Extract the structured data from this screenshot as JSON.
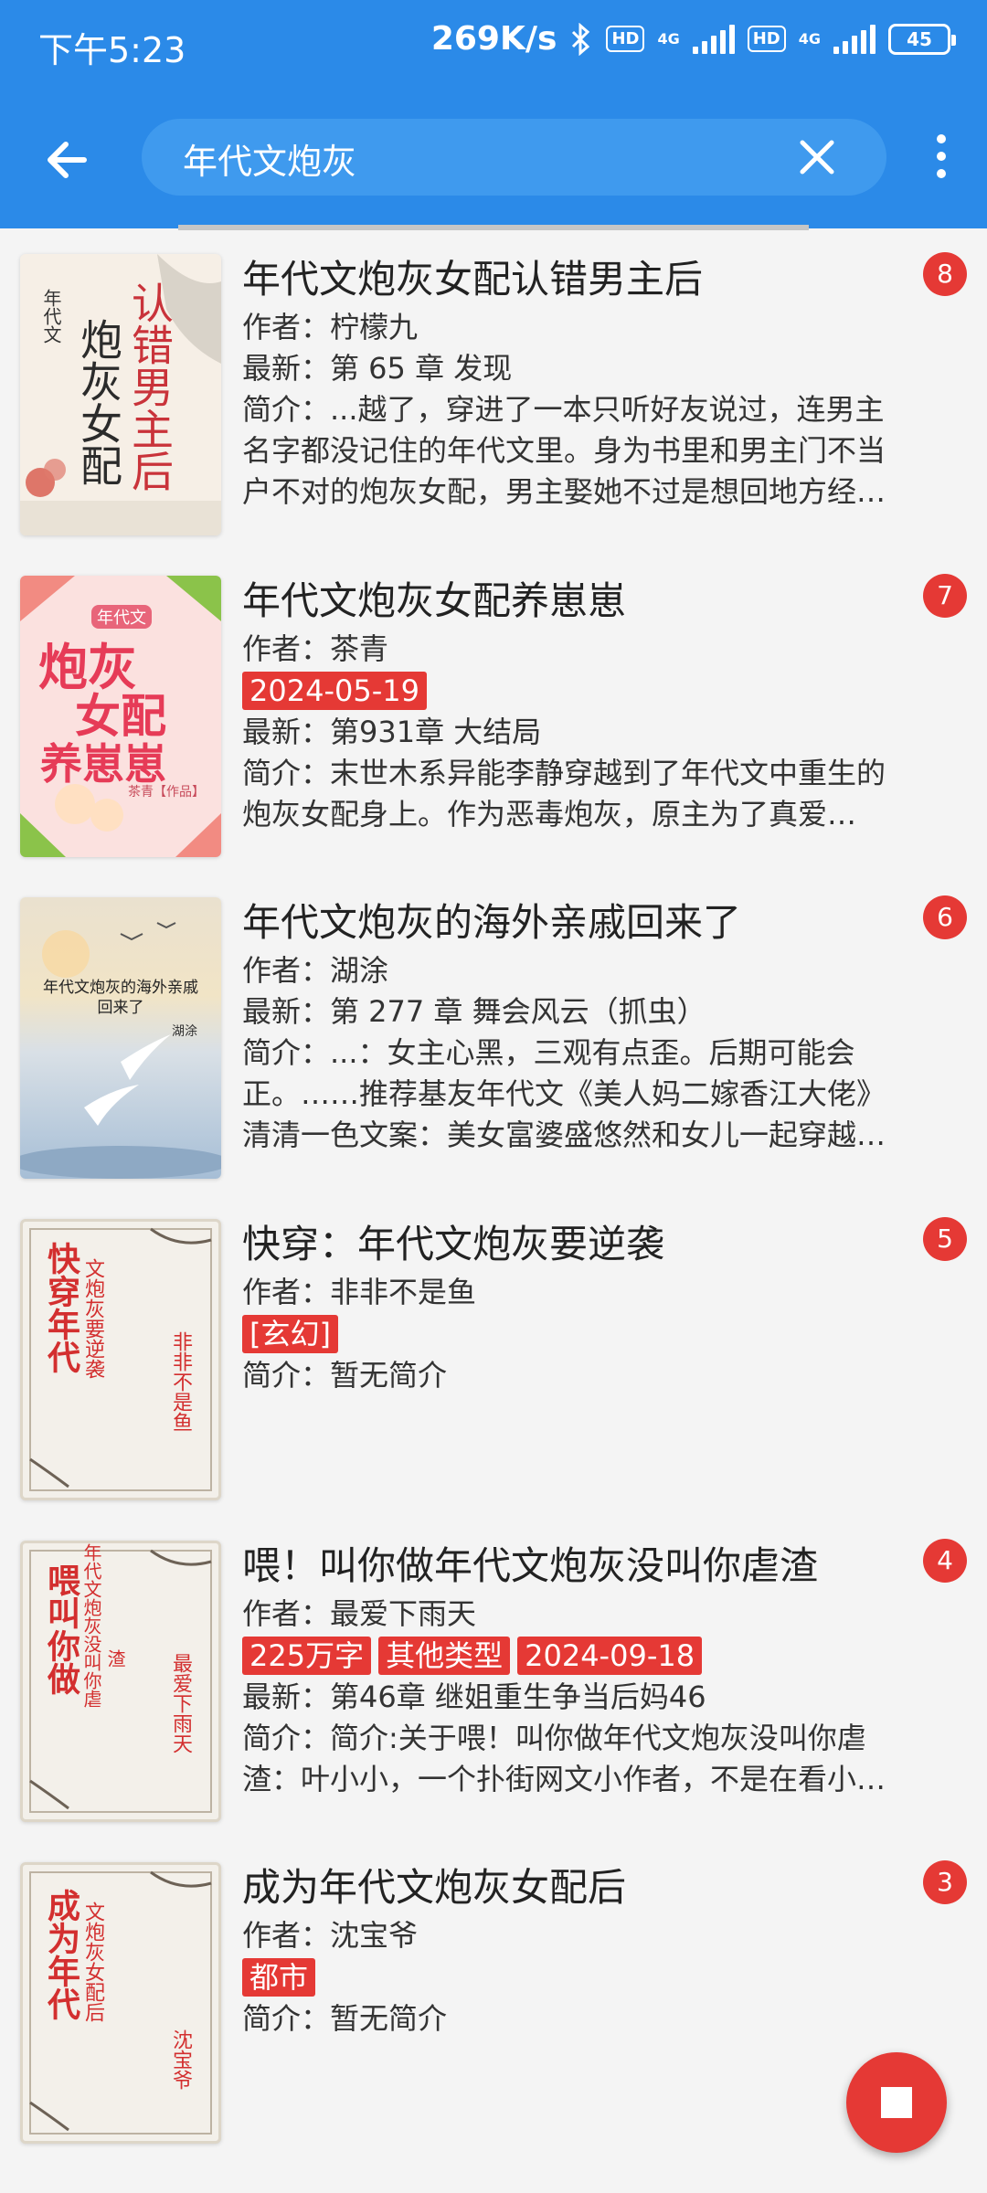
{
  "status_bar": {
    "time": "下午5:23",
    "speed": "269K/s",
    "hd1": "HD",
    "net1": "4G",
    "hd2": "HD",
    "net2": "4G",
    "battery": "45"
  },
  "toolbar": {
    "search_query": "年代文炮灰",
    "back_icon": "arrow-left-icon",
    "clear_icon": "close-icon",
    "more_icon": "more-vert-icon"
  },
  "colors": {
    "header": "#2b8ae8",
    "badge": "#e53935",
    "fab": "#e53935"
  },
  "books": [
    {
      "title": "年代文炮灰女配认错男主后",
      "author": "作者：柠檬九",
      "tags": [],
      "latest": "最新：第 65 章 发现",
      "intro": "简介：...越了，穿进了一本只听好友说过，连男主名字都没记住的年代文里。身为书里和男主门不当户不对的炮灰女配，男主娶她不过是想回地方经…",
      "rank": "8",
      "cover": {
        "top_small": "年代文",
        "col1": "认错男主后",
        "col2": "炮灰女配"
      }
    },
    {
      "title": "年代文炮灰女配养崽崽",
      "author": "作者：茶青",
      "tags": [
        "2024-05-19"
      ],
      "latest": "最新：第931章 大结局",
      "intro": "简介：末世木系异能李静穿越到了年代文中重生的炮灰女配身上。作为恶毒炮灰，原主为了真爱…",
      "rank": "7",
      "cover": {
        "top_small": "年代文",
        "line1": "炮灰",
        "line2": "女配",
        "line3": "养崽崽",
        "byline": "茶青【作品】"
      }
    },
    {
      "title": "年代文炮灰的海外亲戚回来了",
      "author": "作者：湖涂",
      "tags": [],
      "latest": "最新：第 277 章 舞会风云（抓虫）",
      "intro": "简介：...：女主心黑，三观有点歪。后期可能会正。……推荐基友年代文《美人妈二嫁香江大佬》清清一色文案：美女富婆盛悠然和女儿一起穿越…",
      "rank": "6",
      "cover": {
        "title_line1": "年代文炮灰的海外亲戚",
        "title_line2": "回来了",
        "author": "湖涂"
      }
    },
    {
      "title": "快穿：年代文炮灰要逆袭",
      "author": "作者：非非不是鱼",
      "tags": [
        "[玄幻]"
      ],
      "latest": "",
      "intro": "简介：暂无简介",
      "rank": "5",
      "cover": {
        "big": "快穿年代",
        "small": "文炮灰要逆袭",
        "author": "非非不是鱼"
      }
    },
    {
      "title": "喂！叫你做年代文炮灰没叫你虐渣",
      "author": "作者：最爱下雨天",
      "tags": [
        "225万字",
        "其他类型",
        "2024-09-18"
      ],
      "latest": "最新：第46章 继姐重生争当后妈46",
      "intro": "简介：简介:关于喂！叫你做年代文炮灰没叫你虐渣：叶小小，一个扑街网文小作者，不是在看小…",
      "rank": "4",
      "cover": {
        "big": "喂叫你做",
        "small": "年代文炮灰没叫你虐",
        "small2": "渣",
        "author": "最爱下雨天"
      }
    },
    {
      "title": "成为年代文炮灰女配后",
      "author": "作者：沈宝爷",
      "tags": [
        "都市"
      ],
      "latest": "",
      "intro": "简介：暂无简介",
      "rank": "3",
      "cover": {
        "big": "成为年代",
        "small": "文炮灰女配后",
        "author": "沈宝爷"
      }
    }
  ],
  "fab": {
    "icon": "stop-icon"
  }
}
